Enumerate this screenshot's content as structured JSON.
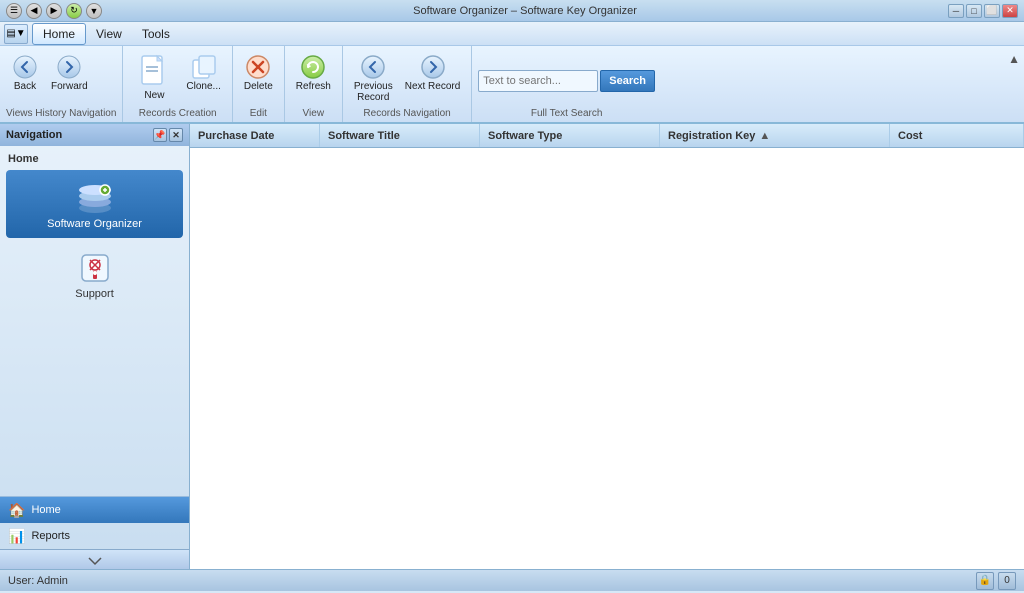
{
  "titlebar": {
    "title": "Software Organizer – Software Key Organizer",
    "min": "─",
    "max": "□",
    "close": "✕"
  },
  "menubar": {
    "icon_label": "▼",
    "items": [
      "Home",
      "View",
      "Tools"
    ]
  },
  "ribbon": {
    "sections": [
      {
        "label": "Views History Navigation",
        "buttons": [
          {
            "icon": "⬅",
            "label": "Back"
          },
          {
            "icon": "➡",
            "label": "Forward"
          }
        ]
      },
      {
        "label": "Records Creation",
        "buttons": [
          {
            "icon": "📄",
            "label": "New",
            "large": true
          },
          {
            "icon": "📋",
            "label": "Clone..."
          }
        ]
      },
      {
        "label": "Edit",
        "buttons": [
          {
            "icon": "✖",
            "label": "Delete"
          }
        ]
      },
      {
        "label": "View",
        "buttons": [
          {
            "icon": "🔄",
            "label": "Refresh",
            "accent": true
          }
        ]
      },
      {
        "label": "Records Navigation",
        "buttons": [
          {
            "icon": "◀",
            "label": "Previous Record"
          },
          {
            "icon": "▶",
            "label": "Next Record"
          }
        ]
      },
      {
        "label": "Full Text Search",
        "search_placeholder": "Text to search...",
        "search_btn": "Search"
      }
    ],
    "collapse_btn": "▲"
  },
  "navigation": {
    "title": "Navigation",
    "home_section": "Home",
    "items": [
      {
        "label": "Software Organizer",
        "icon": "💿",
        "active": true
      },
      {
        "label": "Support",
        "icon": "🩺"
      }
    ],
    "bottom_items": [
      {
        "label": "Home",
        "icon": "🏠",
        "active": true
      },
      {
        "label": "Reports",
        "icon": "📊"
      }
    ],
    "scroll_down": "⬇"
  },
  "table": {
    "columns": [
      {
        "label": "Purchase Date",
        "sort": false
      },
      {
        "label": "Software Title",
        "sort": false
      },
      {
        "label": "Software Type",
        "sort": false
      },
      {
        "label": "Registration Key",
        "sort": true
      },
      {
        "label": "Cost",
        "sort": false
      }
    ]
  },
  "statusbar": {
    "user": "User: Admin",
    "icon1": "🔒",
    "count": "0"
  }
}
